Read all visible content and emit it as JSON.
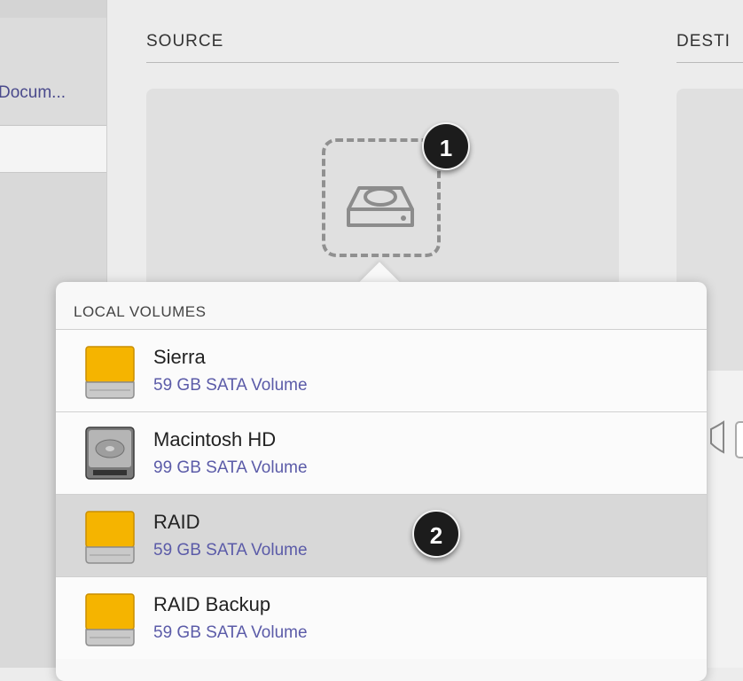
{
  "sidebar": {
    "doc_label": "Docum..."
  },
  "sections": {
    "source_title": "SOURCE",
    "destination_title": "DESTI"
  },
  "source": {
    "badge_1": "1"
  },
  "volume_popover": {
    "header": "LOCAL VOLUMES",
    "badge_2": "2",
    "items": [
      {
        "name": "Sierra",
        "detail": "59 GB SATA Volume",
        "icon": "external-drive-icon"
      },
      {
        "name": "Macintosh HD",
        "detail": "99 GB SATA Volume",
        "icon": "internal-hard-disk-icon"
      },
      {
        "name": "RAID",
        "detail": "59 GB SATA Volume",
        "icon": "external-drive-icon",
        "selected": true
      },
      {
        "name": "RAID Backup",
        "detail": "59 GB SATA Volume",
        "icon": "external-drive-icon"
      }
    ]
  },
  "colors": {
    "accent_text": "#5b5ba8",
    "drive_orange": "#f5b400",
    "selected_row": "#d8d8d8"
  }
}
